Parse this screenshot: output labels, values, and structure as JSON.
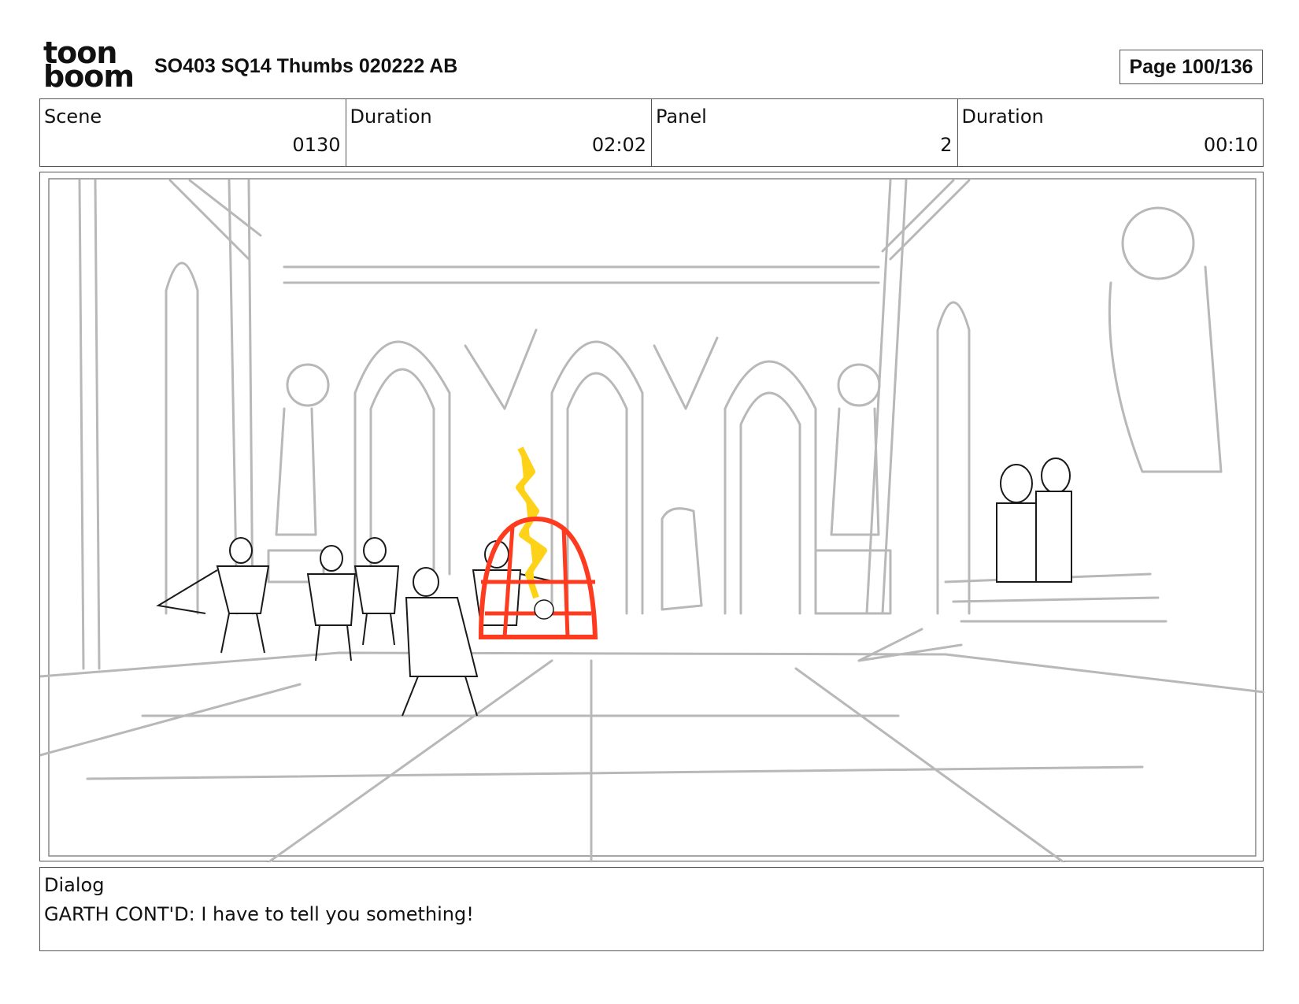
{
  "header": {
    "logo_line1": "toon",
    "logo_line2": "boom",
    "title": "SO403 SQ14 Thumbs 020222 AB",
    "page": "Page 100/136"
  },
  "info": {
    "scene_label": "Scene",
    "scene_value": "0130",
    "duration_label": "Duration",
    "duration_value": "02:02",
    "panel_label": "Panel",
    "panel_value": "2",
    "panel_duration_label": "Duration",
    "panel_duration_value": "00:10"
  },
  "dialog": {
    "label": "Dialog",
    "text": "GARTH CONT'D: I have to tell you something!"
  },
  "colors": {
    "sketch_gray": "#b8b8b8",
    "ink": "#1a1a1a",
    "cage_red": "#ff3b1f",
    "flame_yellow": "#ffd21a"
  }
}
